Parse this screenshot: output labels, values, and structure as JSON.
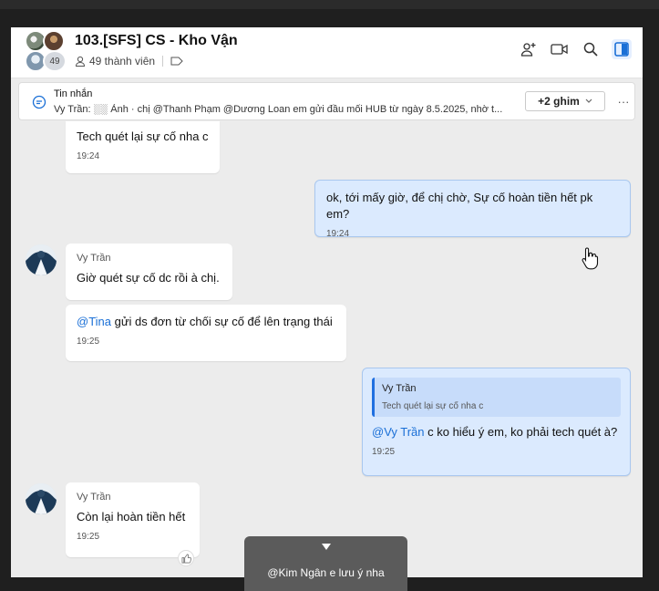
{
  "header": {
    "title": "103.[SFS] CS - Kho Vận",
    "member_count_badge": "49",
    "members_label": "49 thành viên"
  },
  "pinned": {
    "title": "Tin nhắn",
    "text": "Vy Trần: ░░ Ảnh · chị @Thanh Phạm @Dương Loan em gửi đầu mối HUB từ ngày 8.5.2025, nhờ t...",
    "button_label": "+2 ghim",
    "more_label": "···"
  },
  "messages": [
    {
      "text": "Tech quét lại sự cố nha c",
      "time": "19:24"
    },
    {
      "text": "ok, tới mấy giờ, để chị chờ, Sự cố hoàn tiền hết pk em?",
      "time": "19:24"
    },
    {
      "sender": "Vy Trần",
      "text": "Giờ quét sự cố dc rồi à chị."
    },
    {
      "mention": "@Tina",
      "text": " gửi ds đơn từ chối sự cố để lên trạng thái",
      "time": "19:25"
    },
    {
      "quote_name": "Vy Trần",
      "quote_text": "Tech quét lại sự cố nha c",
      "mention": "@Vy Trần",
      "text": " c ko hiểu ý em, ko phải tech quét à?",
      "time": "19:25"
    },
    {
      "sender": "Vy Trần",
      "text": "Còn lại hoàn tiền hết",
      "time": "19:25"
    }
  ],
  "toast": {
    "text": "@Kim Ngân e lưu ý nha"
  },
  "colors": {
    "accent": "#1a6fd6",
    "my_bubble": "#dbeafe",
    "background": "#ececec"
  },
  "icons": [
    "user-add-icon",
    "video-call-icon",
    "search-icon",
    "sidebar-toggle-icon",
    "chat-bubble-icon",
    "chevron-down-icon",
    "thumbs-up-icon",
    "pointer-hand-icon"
  ]
}
